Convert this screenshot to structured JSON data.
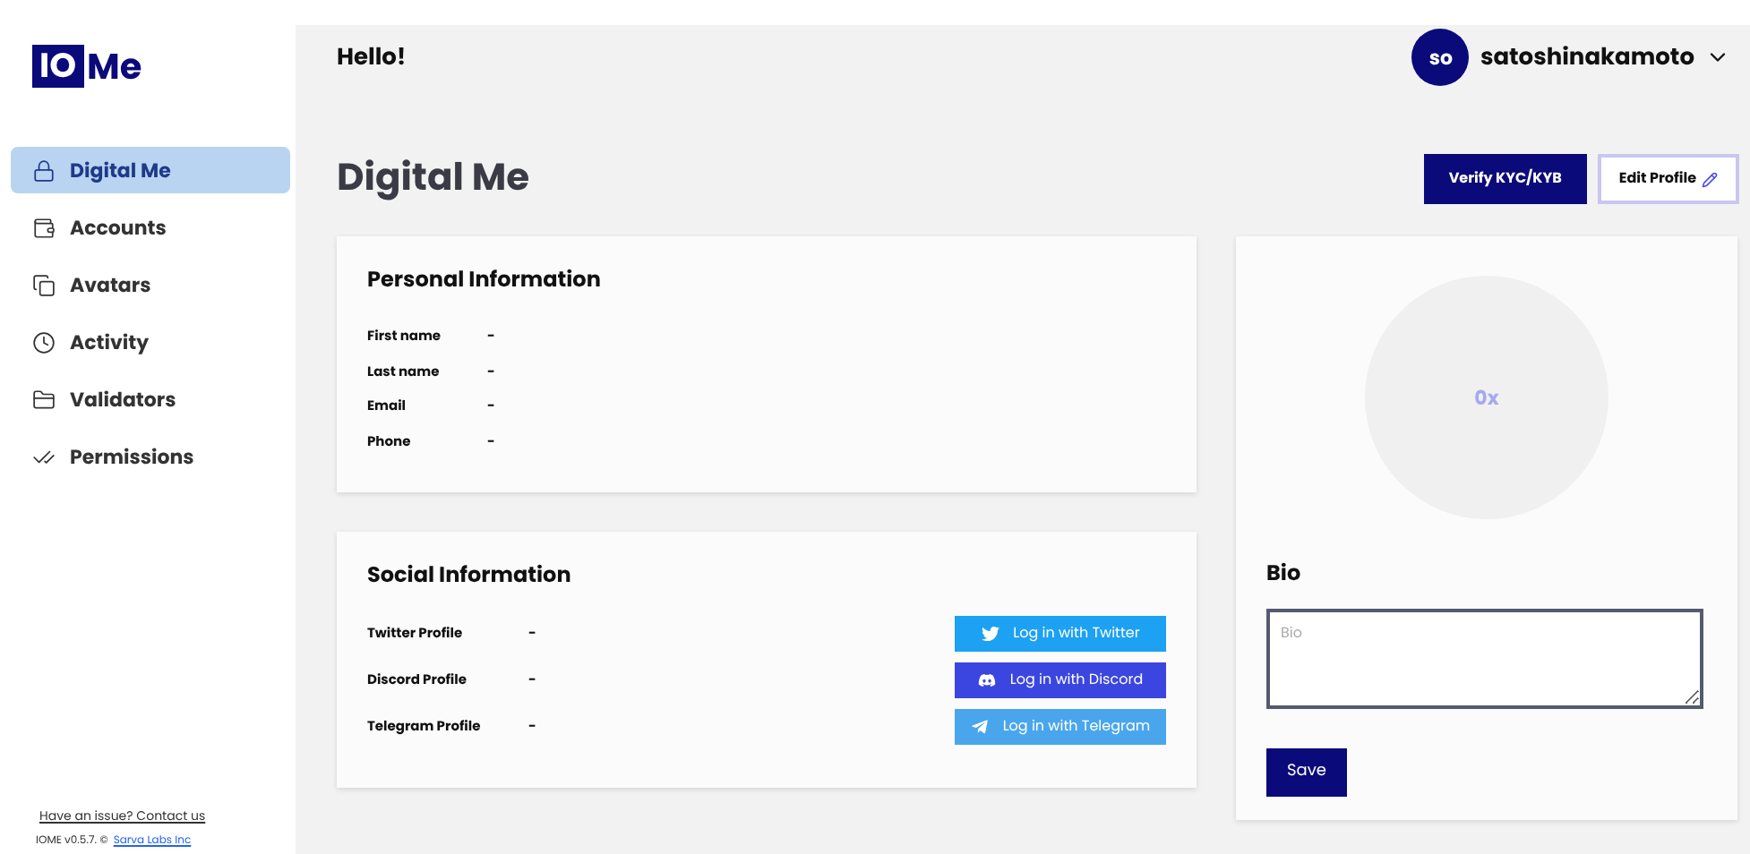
{
  "logo": {
    "mark": "IO",
    "text": "Me"
  },
  "sidebar": {
    "items": [
      {
        "label": "Digital Me",
        "selected": true
      },
      {
        "label": "Accounts",
        "selected": false
      },
      {
        "label": "Avatars",
        "selected": false
      },
      {
        "label": "Activity",
        "selected": false
      },
      {
        "label": "Validators",
        "selected": false
      },
      {
        "label": "Permissions",
        "selected": false
      }
    ],
    "footer": {
      "link": "Have an issue? Contact us",
      "version": "IOME v0.5.7. ©",
      "company": "Sarva Labs Inc"
    }
  },
  "header": {
    "greeting": "Hello!",
    "avatar": "so",
    "username": "satoshinakamoto"
  },
  "page_title": "Digital Me",
  "actions": [
    "Verify KYC/KYB",
    "Edit Profile"
  ],
  "personal": {
    "title": "Personal Information",
    "fields": [
      {
        "label": "First name",
        "value": "-"
      },
      {
        "label": "Last name",
        "value": "-"
      },
      {
        "label": "Email",
        "value": "-"
      },
      {
        "label": "Phone",
        "value": "-"
      }
    ]
  },
  "social": {
    "title": "Social Information",
    "rows": [
      {
        "label": "Twitter Profile",
        "value": "-",
        "button": "Log in with Twitter",
        "color": "#1da1f2"
      },
      {
        "label": "Discord Profile",
        "value": "-",
        "button": "Log in with Discord",
        "color": "#3b46e0"
      },
      {
        "label": "Telegram Profile",
        "value": "-",
        "button": "Log in with Telegram",
        "color": "#4aa6ec"
      }
    ]
  },
  "profile": {
    "address": "0x",
    "bio_title": "Bio",
    "bio_placeholder": "Bio",
    "save": "Save"
  }
}
